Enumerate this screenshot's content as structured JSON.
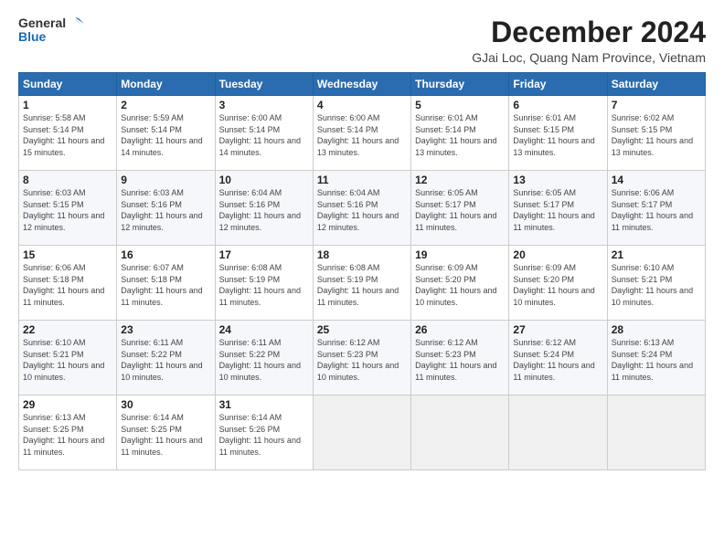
{
  "header": {
    "logo_general": "General",
    "logo_blue": "Blue",
    "title": "December 2024",
    "subtitle": "GJai Loc, Quang Nam Province, Vietnam"
  },
  "weekdays": [
    "Sunday",
    "Monday",
    "Tuesday",
    "Wednesday",
    "Thursday",
    "Friday",
    "Saturday"
  ],
  "weeks": [
    [
      {
        "day": "1",
        "sunrise": "5:58 AM",
        "sunset": "5:14 PM",
        "daylight": "11 hours and 15 minutes."
      },
      {
        "day": "2",
        "sunrise": "5:59 AM",
        "sunset": "5:14 PM",
        "daylight": "11 hours and 14 minutes."
      },
      {
        "day": "3",
        "sunrise": "6:00 AM",
        "sunset": "5:14 PM",
        "daylight": "11 hours and 14 minutes."
      },
      {
        "day": "4",
        "sunrise": "6:00 AM",
        "sunset": "5:14 PM",
        "daylight": "11 hours and 13 minutes."
      },
      {
        "day": "5",
        "sunrise": "6:01 AM",
        "sunset": "5:14 PM",
        "daylight": "11 hours and 13 minutes."
      },
      {
        "day": "6",
        "sunrise": "6:01 AM",
        "sunset": "5:15 PM",
        "daylight": "11 hours and 13 minutes."
      },
      {
        "day": "7",
        "sunrise": "6:02 AM",
        "sunset": "5:15 PM",
        "daylight": "11 hours and 13 minutes."
      }
    ],
    [
      {
        "day": "8",
        "sunrise": "6:03 AM",
        "sunset": "5:15 PM",
        "daylight": "11 hours and 12 minutes."
      },
      {
        "day": "9",
        "sunrise": "6:03 AM",
        "sunset": "5:16 PM",
        "daylight": "11 hours and 12 minutes."
      },
      {
        "day": "10",
        "sunrise": "6:04 AM",
        "sunset": "5:16 PM",
        "daylight": "11 hours and 12 minutes."
      },
      {
        "day": "11",
        "sunrise": "6:04 AM",
        "sunset": "5:16 PM",
        "daylight": "11 hours and 12 minutes."
      },
      {
        "day": "12",
        "sunrise": "6:05 AM",
        "sunset": "5:17 PM",
        "daylight": "11 hours and 11 minutes."
      },
      {
        "day": "13",
        "sunrise": "6:05 AM",
        "sunset": "5:17 PM",
        "daylight": "11 hours and 11 minutes."
      },
      {
        "day": "14",
        "sunrise": "6:06 AM",
        "sunset": "5:17 PM",
        "daylight": "11 hours and 11 minutes."
      }
    ],
    [
      {
        "day": "15",
        "sunrise": "6:06 AM",
        "sunset": "5:18 PM",
        "daylight": "11 hours and 11 minutes."
      },
      {
        "day": "16",
        "sunrise": "6:07 AM",
        "sunset": "5:18 PM",
        "daylight": "11 hours and 11 minutes."
      },
      {
        "day": "17",
        "sunrise": "6:08 AM",
        "sunset": "5:19 PM",
        "daylight": "11 hours and 11 minutes."
      },
      {
        "day": "18",
        "sunrise": "6:08 AM",
        "sunset": "5:19 PM",
        "daylight": "11 hours and 11 minutes."
      },
      {
        "day": "19",
        "sunrise": "6:09 AM",
        "sunset": "5:20 PM",
        "daylight": "11 hours and 10 minutes."
      },
      {
        "day": "20",
        "sunrise": "6:09 AM",
        "sunset": "5:20 PM",
        "daylight": "11 hours and 10 minutes."
      },
      {
        "day": "21",
        "sunrise": "6:10 AM",
        "sunset": "5:21 PM",
        "daylight": "11 hours and 10 minutes."
      }
    ],
    [
      {
        "day": "22",
        "sunrise": "6:10 AM",
        "sunset": "5:21 PM",
        "daylight": "11 hours and 10 minutes."
      },
      {
        "day": "23",
        "sunrise": "6:11 AM",
        "sunset": "5:22 PM",
        "daylight": "11 hours and 10 minutes."
      },
      {
        "day": "24",
        "sunrise": "6:11 AM",
        "sunset": "5:22 PM",
        "daylight": "11 hours and 10 minutes."
      },
      {
        "day": "25",
        "sunrise": "6:12 AM",
        "sunset": "5:23 PM",
        "daylight": "11 hours and 10 minutes."
      },
      {
        "day": "26",
        "sunrise": "6:12 AM",
        "sunset": "5:23 PM",
        "daylight": "11 hours and 11 minutes."
      },
      {
        "day": "27",
        "sunrise": "6:12 AM",
        "sunset": "5:24 PM",
        "daylight": "11 hours and 11 minutes."
      },
      {
        "day": "28",
        "sunrise": "6:13 AM",
        "sunset": "5:24 PM",
        "daylight": "11 hours and 11 minutes."
      }
    ],
    [
      {
        "day": "29",
        "sunrise": "6:13 AM",
        "sunset": "5:25 PM",
        "daylight": "11 hours and 11 minutes."
      },
      {
        "day": "30",
        "sunrise": "6:14 AM",
        "sunset": "5:25 PM",
        "daylight": "11 hours and 11 minutes."
      },
      {
        "day": "31",
        "sunrise": "6:14 AM",
        "sunset": "5:26 PM",
        "daylight": "11 hours and 11 minutes."
      },
      null,
      null,
      null,
      null
    ]
  ]
}
